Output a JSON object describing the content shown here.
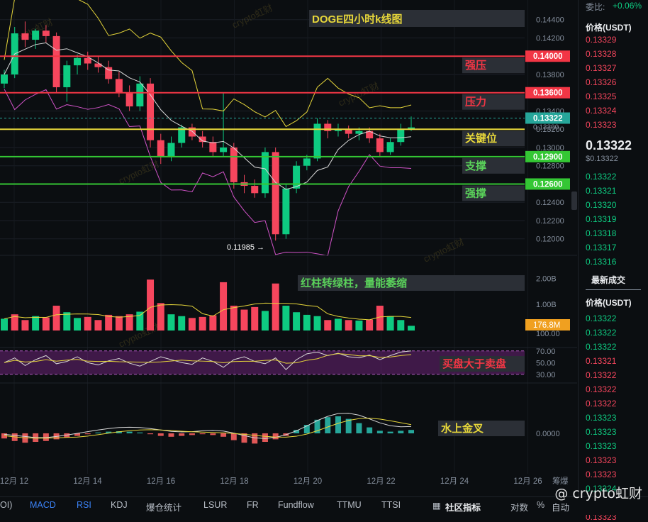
{
  "chart_data": [
    {
      "type": "candlestick",
      "title": "DOGE四小时k线图",
      "y_ticks": [
        "0.14400",
        "0.14200",
        "0.14000",
        "0.13800",
        "0.13600",
        "0.13400",
        "0.13200",
        "0.13000",
        "0.12800",
        "0.12600",
        "0.12400",
        "0.12200",
        "0.12000"
      ],
      "ylim": [
        0.1192,
        0.1446
      ],
      "x_ticks": [
        "12月 12",
        "12月 14",
        "12月 16",
        "12月 18",
        "12月 20",
        "12月 22",
        "12月 24",
        "12月 26"
      ],
      "last_price_tag": "0.13322",
      "hidden_tag": "0.13200",
      "low_marker": "0.11985 →",
      "levels": [
        {
          "label": "强压",
          "price": 0.14,
          "price_label": "0.14000",
          "color": "#f23645"
        },
        {
          "label": "压力",
          "price": 0.136,
          "price_label": "0.13600",
          "color": "#f23645"
        },
        {
          "label": "关键位",
          "price": 0.132,
          "price_label": "",
          "color": "#e6d63a"
        },
        {
          "label": "支撑",
          "price": 0.129,
          "price_label": "0.12900",
          "color": "#34c734"
        },
        {
          "label": "强撑",
          "price": 0.126,
          "price_label": "0.12600",
          "color": "#34c734"
        }
      ],
      "candles": [
        [
          0.137,
          0.1385,
          0.1365,
          0.138
        ],
        [
          0.138,
          0.1432,
          0.1376,
          0.1425
        ],
        [
          0.1425,
          0.1438,
          0.141,
          0.1418
        ],
        [
          0.1418,
          0.143,
          0.1408,
          0.1428
        ],
        [
          0.1428,
          0.1434,
          0.1415,
          0.1422
        ],
        [
          0.1422,
          0.1426,
          0.136,
          0.1366
        ],
        [
          0.1366,
          0.1395,
          0.135,
          0.139
        ],
        [
          0.139,
          0.1402,
          0.138,
          0.1398
        ],
        [
          0.1398,
          0.1405,
          0.1385,
          0.1392
        ],
        [
          0.1392,
          0.14,
          0.1382,
          0.1388
        ],
        [
          0.1388,
          0.1395,
          0.137,
          0.1375
        ],
        [
          0.1375,
          0.1383,
          0.1355,
          0.136
        ],
        [
          0.136,
          0.1368,
          0.134,
          0.1345
        ],
        [
          0.1345,
          0.1378,
          0.134,
          0.137
        ],
        [
          0.137,
          0.1376,
          0.13,
          0.1308
        ],
        [
          0.1308,
          0.1315,
          0.1282,
          0.129
        ],
        [
          0.129,
          0.1312,
          0.1285,
          0.1305
        ],
        [
          0.1305,
          0.1325,
          0.13,
          0.1322
        ],
        [
          0.1322,
          0.1326,
          0.1308,
          0.1312
        ],
        [
          0.1312,
          0.1318,
          0.13,
          0.1306
        ],
        [
          0.1306,
          0.1312,
          0.129,
          0.1295
        ],
        [
          0.1295,
          0.136,
          0.129,
          0.13
        ],
        [
          0.13,
          0.1305,
          0.1255,
          0.1262
        ],
        [
          0.1262,
          0.127,
          0.125,
          0.1258
        ],
        [
          0.1258,
          0.1265,
          0.1245,
          0.125
        ],
        [
          0.125,
          0.13,
          0.1245,
          0.1295
        ],
        [
          0.1295,
          0.13,
          0.1198,
          0.1205
        ],
        [
          0.1205,
          0.126,
          0.12,
          0.1255
        ],
        [
          0.1255,
          0.1285,
          0.125,
          0.128
        ],
        [
          0.128,
          0.1292,
          0.1275,
          0.1288
        ],
        [
          0.1288,
          0.1332,
          0.1285,
          0.1326
        ],
        [
          0.1326,
          0.133,
          0.131,
          0.1318
        ],
        [
          0.1318,
          0.1326,
          0.1312,
          0.132
        ],
        [
          0.132,
          0.1324,
          0.131,
          0.1315
        ],
        [
          0.1315,
          0.1322,
          0.1308,
          0.1318
        ],
        [
          0.1318,
          0.1322,
          0.1305,
          0.131
        ],
        [
          0.131,
          0.1315,
          0.129,
          0.1295
        ],
        [
          0.1295,
          0.131,
          0.1292,
          0.1306
        ],
        [
          0.1306,
          0.1326,
          0.1302,
          0.132
        ],
        [
          0.132,
          0.1334,
          0.1318,
          0.1322
        ]
      ]
    },
    {
      "type": "bar",
      "title": "红柱转绿柱，量能萎缩",
      "y_ticks": [
        "2.00B",
        "1.00B"
      ],
      "ylim": [
        0,
        2.2
      ],
      "unit": "B",
      "last_value_tag": "176.8M",
      "values": [
        0.45,
        0.62,
        0.4,
        0.55,
        0.5,
        0.95,
        0.7,
        0.48,
        0.52,
        0.4,
        0.6,
        0.55,
        0.62,
        0.72,
        1.95,
        1.05,
        0.62,
        0.55,
        0.48,
        0.52,
        0.58,
        1.85,
        0.95,
        0.8,
        0.9,
        0.75,
        1.8,
        0.95,
        0.7,
        0.6,
        0.55,
        0.4,
        0.45,
        0.4,
        0.38,
        0.42,
        0.95,
        0.55,
        0.4,
        0.18
      ],
      "colors": [
        "#0ecb81",
        "#f6465d",
        "#f6465d",
        "#0ecb81",
        "#f6465d",
        "#f6465d",
        "#0ecb81",
        "#0ecb81",
        "#f6465d",
        "#f6465d",
        "#f6465d",
        "#f6465d",
        "#f6465d",
        "#0ecb81",
        "#f6465d",
        "#f6465d",
        "#0ecb81",
        "#0ecb81",
        "#f6465d",
        "#f6465d",
        "#f6465d",
        "#f6465d",
        "#f6465d",
        "#f6465d",
        "#f6465d",
        "#0ecb81",
        "#f6465d",
        "#0ecb81",
        "#0ecb81",
        "#0ecb81",
        "#0ecb81",
        "#f6465d",
        "#0ecb81",
        "#f6465d",
        "#0ecb81",
        "#f6465d",
        "#f6465d",
        "#0ecb81",
        "#0ecb81",
        "#0ecb81"
      ]
    },
    {
      "type": "line",
      "title": "买盘大于卖盘",
      "y_ticks": [
        "100.00",
        "70.00",
        "50.00",
        "30.00"
      ],
      "ylim": [
        20,
        100
      ]
    },
    {
      "type": "bar",
      "title": "水上金叉",
      "y_ticks": [
        "0.0000"
      ],
      "values": [
        -0.6,
        -0.9,
        -1.1,
        -1.0,
        -0.9,
        -0.7,
        -0.5,
        -0.3,
        -0.1,
        0.1,
        0.2,
        0.25,
        0.2,
        0.1,
        -0.1,
        -0.3,
        -0.4,
        -0.3,
        -0.2,
        -0.1,
        -0.2,
        -0.4,
        -0.8,
        -1.1,
        -1.2,
        -1.0,
        -0.7,
        -0.3,
        0.4,
        1.0,
        1.6,
        1.9,
        2.0,
        1.7,
        1.2,
        0.7,
        0.3,
        0.2,
        0.3,
        0.4
      ]
    }
  ],
  "watermarks": [
    "crypto虹财",
    "crypto虹财",
    "crypto虹财",
    "crypto虹财",
    "crypto虹财",
    "crypto虹财"
  ],
  "right_panel": {
    "change": "+0.06%",
    "change_label": "委比:",
    "price_header": "价格(USDT)",
    "asks": [
      "0.13329",
      "0.13328",
      "0.13327",
      "0.13326",
      "0.13325",
      "0.13324",
      "0.13323"
    ],
    "last_price": "0.13322",
    "last_price_sub": "$0.13322",
    "bids": [
      "0.13322",
      "0.13321",
      "0.13320",
      "0.13319",
      "0.13318",
      "0.13317",
      "0.13316"
    ],
    "trades_title": "最新成交",
    "trades_header": "价格(USDT)",
    "trades": [
      {
        "p": "0.13322",
        "c": "bid"
      },
      {
        "p": "0.13322",
        "c": "bid"
      },
      {
        "p": "0.13322",
        "c": "bid"
      },
      {
        "p": "0.13321",
        "c": "ask"
      },
      {
        "p": "0.13322",
        "c": "ask"
      },
      {
        "p": "0.13322",
        "c": "ask"
      },
      {
        "p": "0.13322",
        "c": "ask"
      },
      {
        "p": "0.13323",
        "c": "bid"
      },
      {
        "p": "0.13323",
        "c": "bid"
      },
      {
        "p": "0.13323",
        "c": "bid"
      },
      {
        "p": "0.13323",
        "c": "ask"
      },
      {
        "p": "0.13323",
        "c": "ask"
      },
      {
        "p": "0.13324",
        "c": "bid"
      },
      {
        "p": "0.13323",
        "c": "ask"
      },
      {
        "p": "0.13323",
        "c": "ask"
      }
    ]
  },
  "tabs": {
    "first": "OI)",
    "items": [
      "MACD",
      "RSI",
      "KDJ",
      "爆仓统计",
      "LSUR",
      "FR",
      "Fundflow",
      "TTMU",
      "TTSI"
    ],
    "community": "社区指标",
    "right_items": [
      "对数",
      "%",
      "自动"
    ],
    "xtra": [
      "筹",
      "爆"
    ]
  },
  "brand": "@ crypto虹财",
  "colors": {
    "up": "#0ecb81",
    "down": "#f6465d",
    "bg": "#0b0e11"
  }
}
